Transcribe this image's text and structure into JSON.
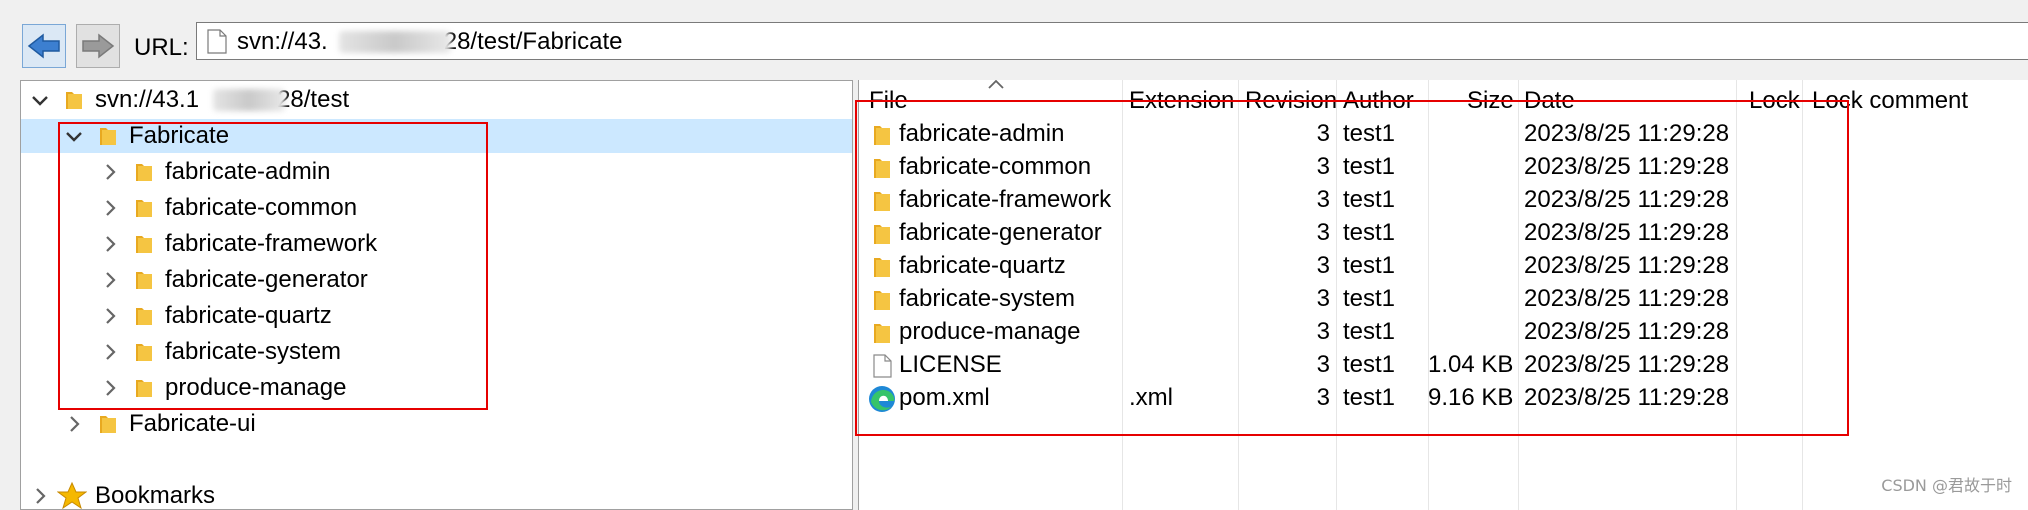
{
  "toolbar": {
    "back_icon": "back-arrow-icon",
    "forward_icon": "forward-arrow-icon",
    "url_label": "URL:",
    "url_value_prefix": "svn://43.",
    "url_value_suffix": "28/test/Fabricate"
  },
  "tree": {
    "root": {
      "label_prefix": "svn://43.1",
      "label_suffix": "28/test"
    },
    "selected": {
      "label": "Fabricate"
    },
    "children": [
      {
        "label": "fabricate-admin"
      },
      {
        "label": "fabricate-common"
      },
      {
        "label": "fabricate-framework"
      },
      {
        "label": "fabricate-generator"
      },
      {
        "label": "fabricate-quartz"
      },
      {
        "label": "fabricate-system"
      },
      {
        "label": "produce-manage"
      }
    ],
    "sibling": {
      "label": "Fabricate-ui"
    },
    "bookmarks": {
      "label": "Bookmarks"
    }
  },
  "list": {
    "columns": {
      "file": "File",
      "extension": "Extension",
      "revision": "Revision",
      "author": "Author",
      "size": "Size",
      "date": "Date",
      "lock": "Lock",
      "lock_comment": "Lock comment"
    },
    "rows": [
      {
        "icon": "folder",
        "file": "fabricate-admin",
        "extension": "",
        "revision": "3",
        "author": "test1",
        "size": "",
        "date": "2023/8/25 11:29:28"
      },
      {
        "icon": "folder",
        "file": "fabricate-common",
        "extension": "",
        "revision": "3",
        "author": "test1",
        "size": "",
        "date": "2023/8/25 11:29:28"
      },
      {
        "icon": "folder",
        "file": "fabricate-framework",
        "extension": "",
        "revision": "3",
        "author": "test1",
        "size": "",
        "date": "2023/8/25 11:29:28"
      },
      {
        "icon": "folder",
        "file": "fabricate-generator",
        "extension": "",
        "revision": "3",
        "author": "test1",
        "size": "",
        "date": "2023/8/25 11:29:28"
      },
      {
        "icon": "folder",
        "file": "fabricate-quartz",
        "extension": "",
        "revision": "3",
        "author": "test1",
        "size": "",
        "date": "2023/8/25 11:29:28"
      },
      {
        "icon": "folder",
        "file": "fabricate-system",
        "extension": "",
        "revision": "3",
        "author": "test1",
        "size": "",
        "date": "2023/8/25 11:29:28"
      },
      {
        "icon": "folder",
        "file": "produce-manage",
        "extension": "",
        "revision": "3",
        "author": "test1",
        "size": "",
        "date": "2023/8/25 11:29:28"
      },
      {
        "icon": "document",
        "file": "LICENSE",
        "extension": "",
        "revision": "3",
        "author": "test1",
        "size": "1.04 KB",
        "date": "2023/8/25 11:29:28"
      },
      {
        "icon": "edge-browser",
        "file": "pom.xml",
        "extension": ".xml",
        "revision": "3",
        "author": "test1",
        "size": "9.16 KB",
        "date": "2023/8/25 11:29:28"
      }
    ]
  },
  "watermark": "CSDN @君故于时",
  "colors": {
    "selection": "#cce8ff",
    "highlight_box": "#e60000",
    "folder": "#f5c542"
  }
}
